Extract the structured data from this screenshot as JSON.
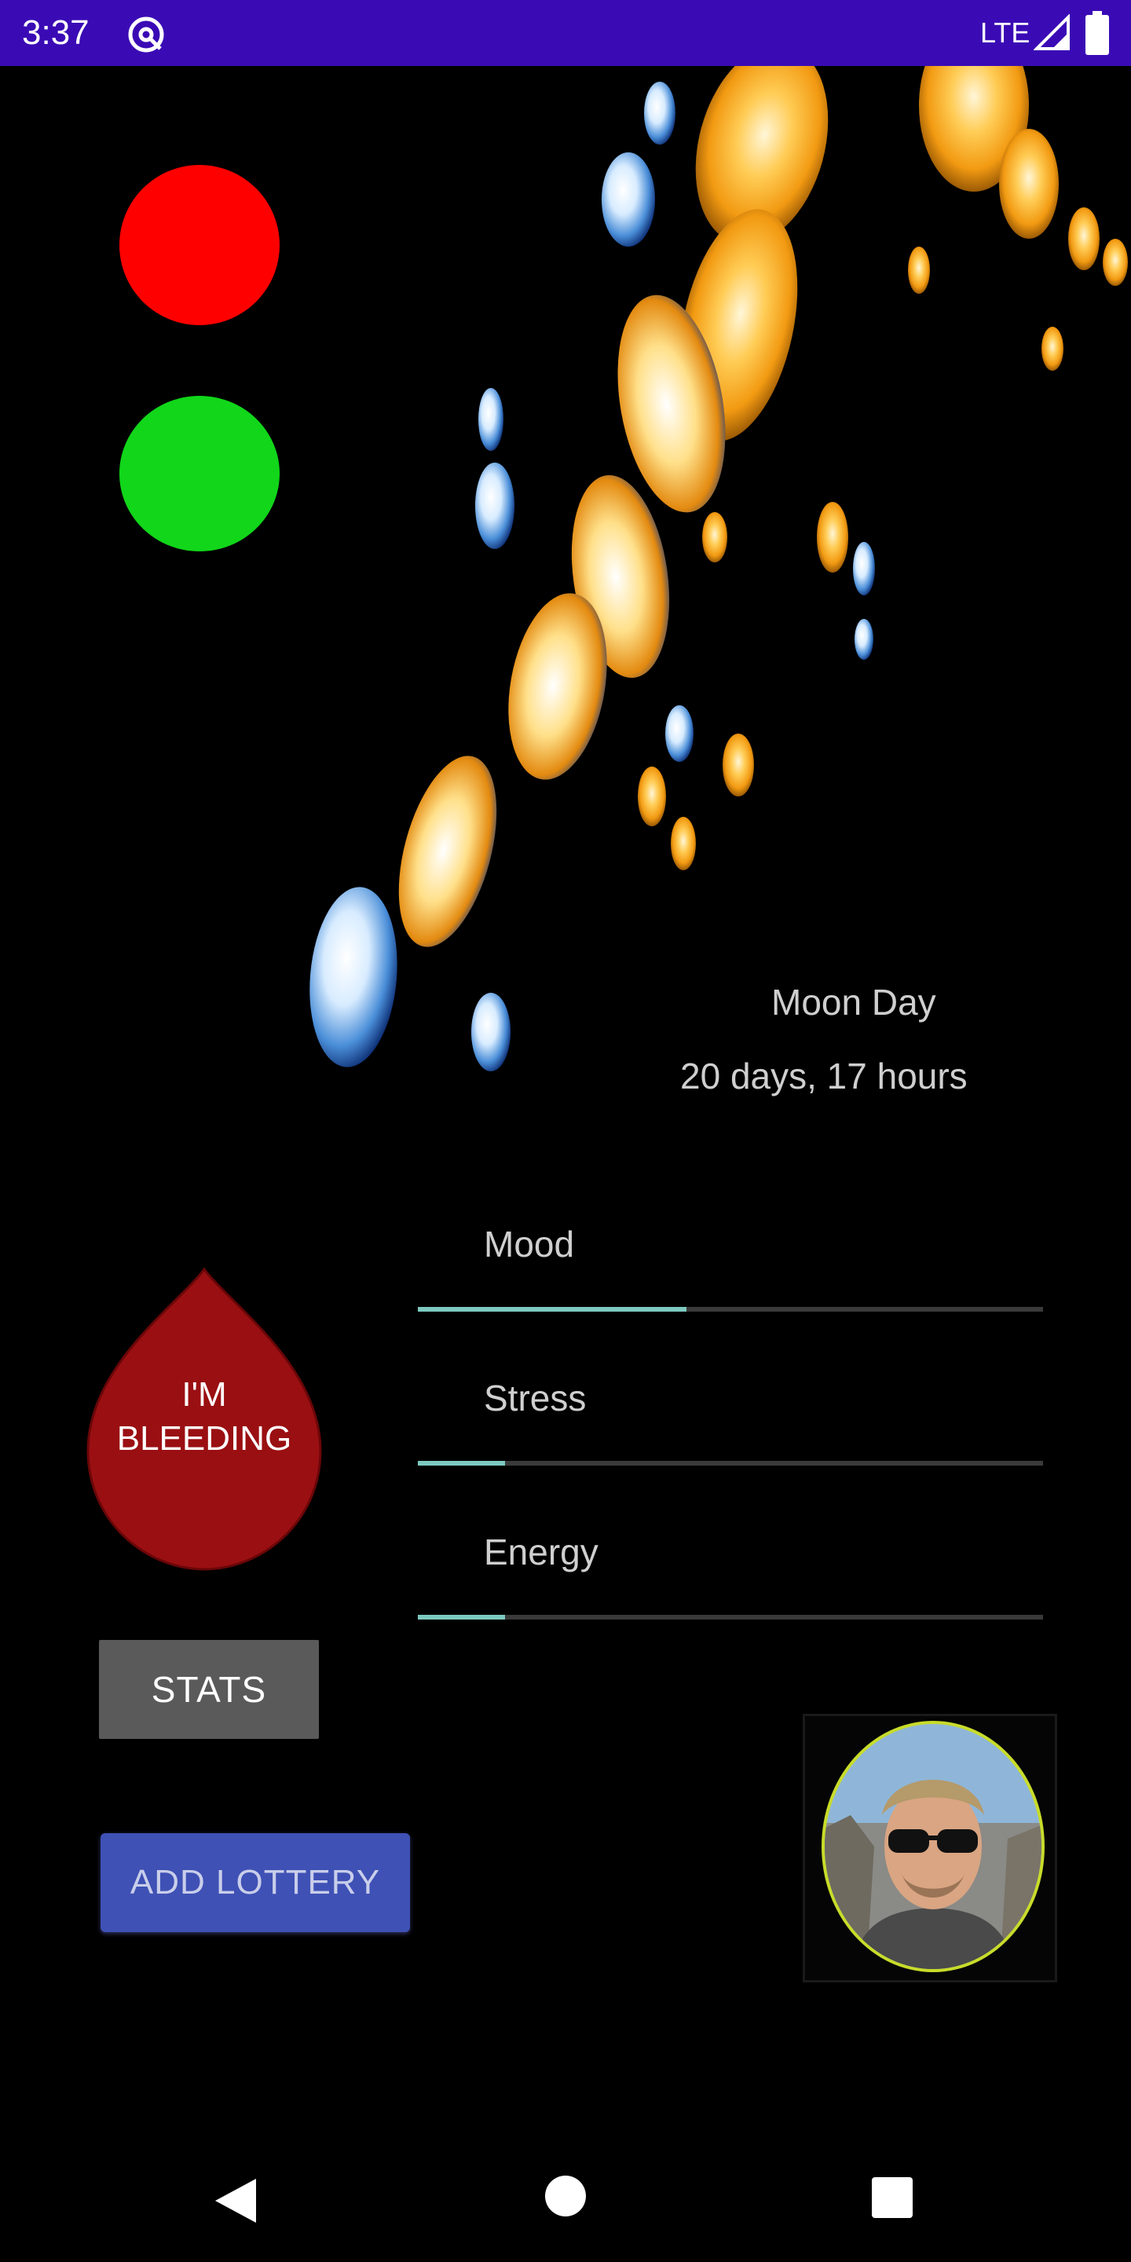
{
  "status_bar": {
    "time": "3:37",
    "network": "LTE",
    "background": "#3a0bb5"
  },
  "indicators": {
    "top_color": "#ff0000",
    "bottom_color": "#11d61a"
  },
  "moon": {
    "label": "Moon Day",
    "value": "20 days, 17 hours"
  },
  "bleeding_button": {
    "line1": "I'M",
    "line2": "BLEEDING",
    "color": "#9a0f12"
  },
  "sliders": [
    {
      "label": "Mood",
      "level": 0.43
    },
    {
      "label": "Stress",
      "level": 0.14
    },
    {
      "label": "Energy",
      "level": 0.14
    }
  ],
  "buttons": {
    "stats": "STATS",
    "add_lottery": "ADD LOTTERY"
  },
  "icons": {
    "status_app": "at-sign-icon",
    "signal": "signal-icon",
    "battery": "battery-icon",
    "back": "back-triangle-icon",
    "home": "home-circle-icon",
    "recent": "recents-square-icon"
  }
}
